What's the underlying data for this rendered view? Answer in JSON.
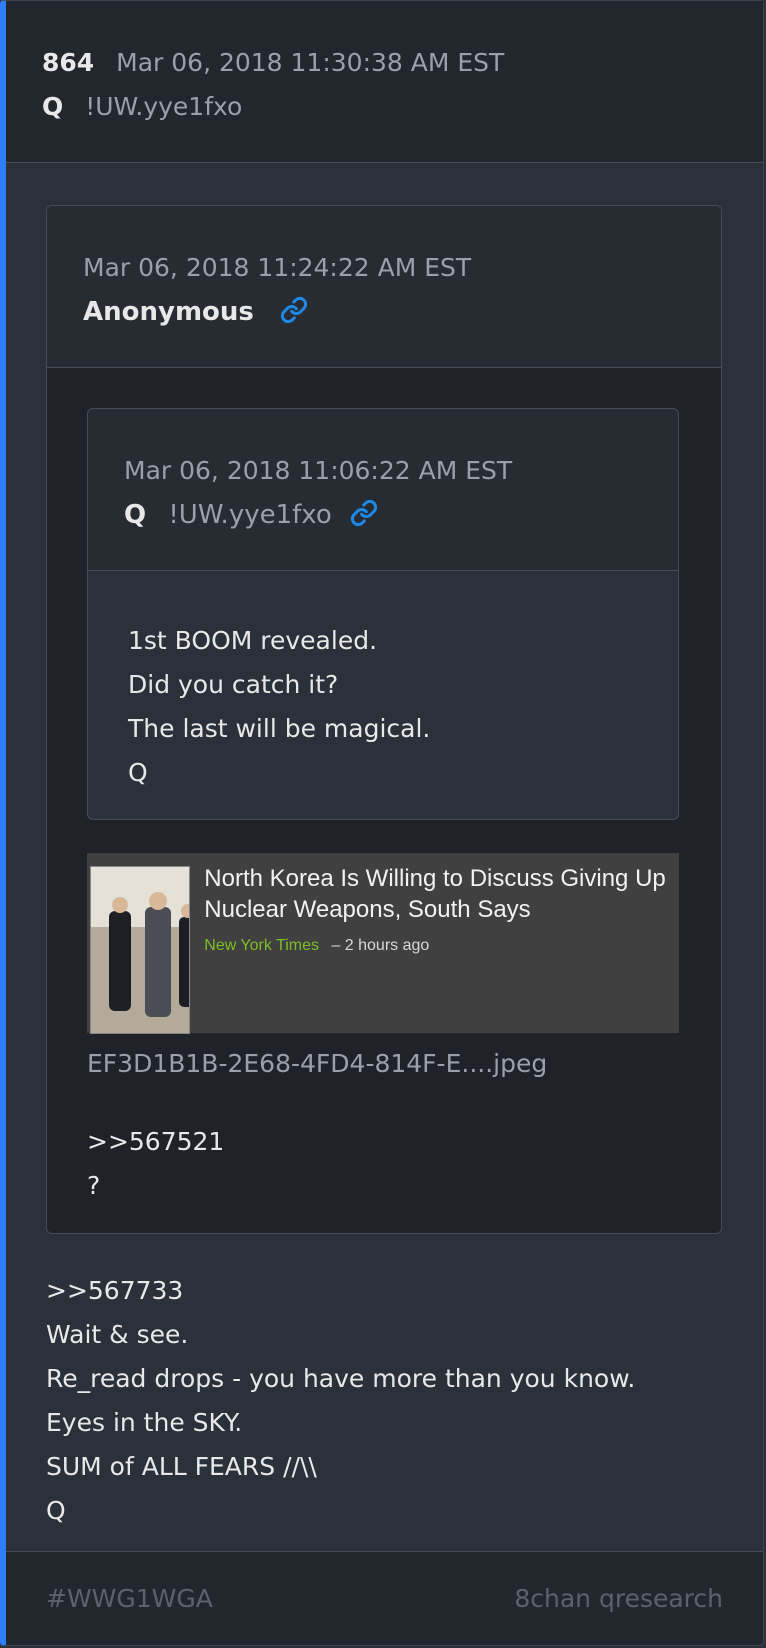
{
  "post": {
    "number": "864",
    "timestamp": "Mar 06, 2018 11:30:38 AM EST",
    "author": "Q",
    "tripcode": "!UW.yye1fxo"
  },
  "quoted": {
    "timestamp": "Mar 06, 2018 11:24:22 AM EST",
    "author": "Anonymous",
    "nested": {
      "timestamp": "Mar 06, 2018 11:06:22 AM EST",
      "author": "Q",
      "tripcode": "!UW.yye1fxo",
      "lines": [
        "1st BOOM revealed.",
        "Did you catch it?",
        "The last will be magical.",
        "Q"
      ]
    },
    "news": {
      "title": "North Korea Is Willing to Discuss Giving Up Nuclear Weapons, South Says",
      "source": "New York Times",
      "age": "– 2 hours ago"
    },
    "filename": "EF3D1B1B-2E68-4FD4-814F-E....jpeg",
    "lines": [
      ">>567521",
      "?"
    ]
  },
  "body": {
    "lines": [
      ">>567733",
      "Wait & see.",
      "Re_read drops - you have more than you know.",
      "Eyes in the SKY.",
      "SUM of ALL FEARS //\\\\",
      "Q"
    ]
  },
  "footer": {
    "hashtag": "#WWG1WGA",
    "source": "8chan qresearch"
  },
  "colors": {
    "accent": "#2d7ff9",
    "link_icon": "#1e88e5",
    "news_source": "#7cbf24"
  }
}
